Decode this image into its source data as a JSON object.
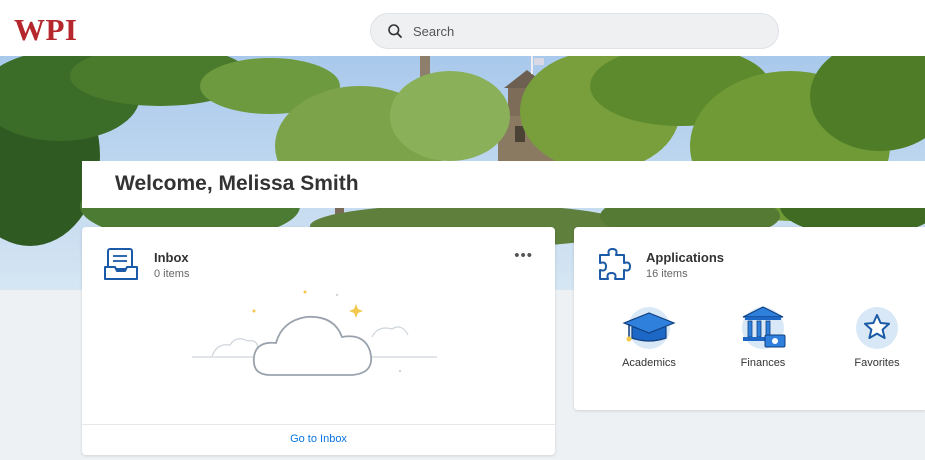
{
  "brand": {
    "logo_text": "WPI",
    "accent": "#b5262d",
    "link_color": "#0875e1"
  },
  "search": {
    "placeholder": "Search"
  },
  "welcome": {
    "text": "Welcome, Melissa Smith"
  },
  "inbox": {
    "title": "Inbox",
    "subtitle": "0 items",
    "icon": "inbox-tray-icon",
    "empty_state_icon": "cloud-illustration",
    "more_icon": "more-horizontal-icon",
    "more_label": "•••",
    "footer_link": "Go to Inbox"
  },
  "applications": {
    "title": "Applications",
    "subtitle": "16 items",
    "icon": "puzzle-piece-icon",
    "apps": [
      {
        "label": "Academics",
        "icon": "graduation-cap-icon"
      },
      {
        "label": "Finances",
        "icon": "bank-building-icon"
      },
      {
        "label": "Favorites",
        "icon": "star-icon"
      }
    ]
  }
}
